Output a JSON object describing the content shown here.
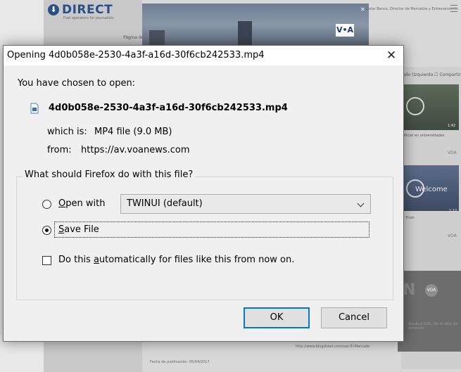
{
  "background_page": {
    "logo_text": "DIRECT",
    "logo_sub": "Fuel operators for journalists",
    "pagina": "Página de",
    "top_right_text": "Ioslar Banco, Director de Mercados y Entrenamiento",
    "share_text": "ndo (Izquierda  ☐ Compartir",
    "univ_text": "Aficial en universidades",
    "welcome_text": "Welcome",
    "trump_text": "s Trum",
    "thumb_time_1": "1:42",
    "thumb_time_2": "1:12",
    "voa_small": "VOA",
    "voa_badge": "V•A",
    "n_letter": "N",
    "voa_circle": "VOA",
    "side_bottom_text": "Ayuda a VOA. Ver el sitio de donación",
    "bottom_url": "http://www.blogsheet.com/sas-El-Mercado",
    "pub_date": "Fecha de publicación: 05/04/2017"
  },
  "dialog": {
    "title": "Opening 4d0b058e-2530-4a3f-a16d-30f6cb242533.mp4",
    "close_glyph": "✕",
    "intro": "You have chosen to open:",
    "filename": "4d0b058e-2530-4a3f-a16d-30f6cb242533.mp4",
    "which_is_label": "which is:",
    "which_is_value": "MP4 file (9.0 MB)",
    "from_label": "from:",
    "from_value": "https://av.voanews.com",
    "question": "What should Firefox do with this file?",
    "open_with_accel": "O",
    "open_with_rest": "pen with",
    "open_with_app": "TWINUI (default)",
    "save_accel": "S",
    "save_rest": "ave File",
    "selected_option": "save",
    "auto_pre": "Do this ",
    "auto_accel": "a",
    "auto_rest": "utomatically for files like this from now on.",
    "auto_checked": false,
    "ok_label": "OK",
    "cancel_label": "Cancel"
  },
  "icons": [
    "voa-logo-icon",
    "close-icon",
    "file-icon",
    "chevron-down-icon",
    "play-icon",
    "hamburger-icon"
  ],
  "colors": {
    "accent": "#0078d7",
    "dialog_bg": "#f0f0f0",
    "voa_blue": "#2a4f86"
  }
}
